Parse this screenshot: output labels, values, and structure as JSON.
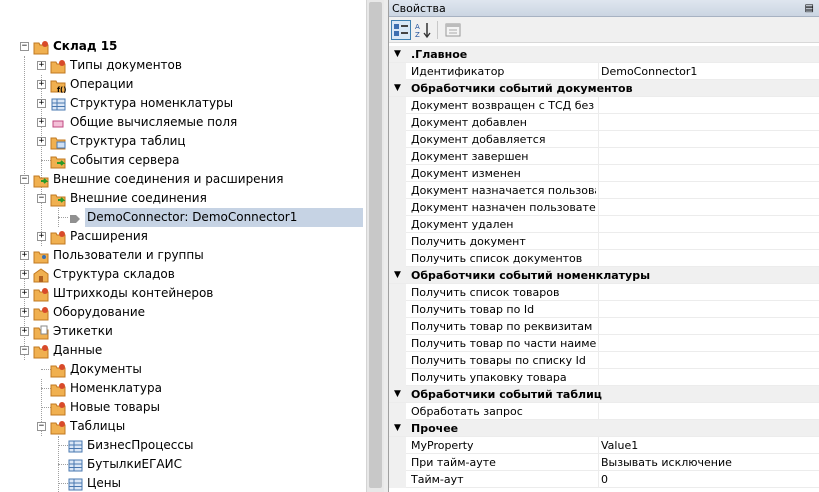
{
  "tree": {
    "items": [
      {
        "label": "Склад 15",
        "icon": "folder-gear-icon",
        "bold": true
      },
      {
        "label": "Типы документов",
        "icon": "folder-gear-icon"
      },
      {
        "label": "Операции",
        "icon": "operations-icon"
      },
      {
        "label": "Структура номенклатуры",
        "icon": "table-icon"
      },
      {
        "label": "Общие вычисляемые поля",
        "icon": "calc-field-icon"
      },
      {
        "label": "Структура таблиц",
        "icon": "folder-table-icon"
      },
      {
        "label": "События сервера",
        "icon": "server-event-icon"
      },
      {
        "label": "Внешние соединения и расширения",
        "icon": "folder-connect-icon"
      },
      {
        "label": "Внешние соединения",
        "icon": "folder-connect-icon"
      },
      {
        "label": "DemoConnector: DemoConnector1",
        "icon": "connector-arrow-icon",
        "selected": true
      },
      {
        "label": "Расширения",
        "icon": "folder-gear-icon"
      },
      {
        "label": "Пользователи и группы",
        "icon": "folder-users-icon"
      },
      {
        "label": "Структура складов",
        "icon": "warehouse-icon"
      },
      {
        "label": "Штрихкоды контейнеров",
        "icon": "folder-gear-icon"
      },
      {
        "label": "Оборудование",
        "icon": "folder-gear-icon"
      },
      {
        "label": "Этикетки",
        "icon": "folder-label-icon"
      },
      {
        "label": "Данные",
        "icon": "folder-gear-icon"
      },
      {
        "label": "Документы",
        "icon": "folder-gear-icon"
      },
      {
        "label": "Номенклатура",
        "icon": "folder-gear-icon"
      },
      {
        "label": "Новые товары",
        "icon": "folder-gear-icon"
      },
      {
        "label": "Таблицы",
        "icon": "folder-gear-icon"
      },
      {
        "label": "БизнесПроцессы",
        "icon": "table-icon"
      },
      {
        "label": "БутылкиЕГАИС",
        "icon": "table-icon"
      },
      {
        "label": "Цены",
        "icon": "table-icon"
      }
    ]
  },
  "props": {
    "title": "Свойства",
    "pin": "ф",
    "categories": [
      {
        "name": ".Главное",
        "rows": [
          [
            "Идентификатор",
            "DemoConnector1"
          ]
        ]
      },
      {
        "name": "Обработчики событий документов",
        "rows": [
          [
            "Документ возвращен с ТСД без обр",
            ""
          ],
          [
            "Документ добавлен",
            ""
          ],
          [
            "Документ добавляется",
            ""
          ],
          [
            "Документ завершен",
            ""
          ],
          [
            "Документ изменен",
            ""
          ],
          [
            "Документ назначается пользовател",
            ""
          ],
          [
            "Документ назначен пользователю",
            ""
          ],
          [
            "Документ удален",
            ""
          ],
          [
            "Получить документ",
            ""
          ],
          [
            "Получить список документов",
            ""
          ]
        ]
      },
      {
        "name": "Обработчики событий номенклатуры",
        "rows": [
          [
            "Получить список товаров",
            ""
          ],
          [
            "Получить товар по Id",
            ""
          ],
          [
            "Получить товар по реквизитам (Шт",
            ""
          ],
          [
            "Получить товар по части наименов",
            ""
          ],
          [
            "Получить товары по списку Id",
            ""
          ],
          [
            "Получить упаковку товара",
            ""
          ]
        ]
      },
      {
        "name": "Обработчики событий таблиц",
        "rows": [
          [
            "Обработать запрос",
            ""
          ]
        ]
      },
      {
        "name": "Прочее",
        "rows": [
          [
            "MyProperty",
            "Value1"
          ],
          [
            "При тайм-ауте",
            "Вызывать исключение"
          ],
          [
            "Тайм-аут",
            "0"
          ]
        ]
      }
    ]
  }
}
